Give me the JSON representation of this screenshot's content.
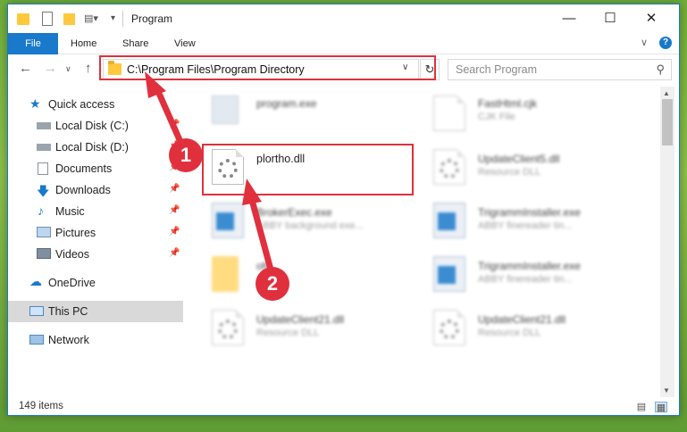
{
  "window": {
    "title": "Program"
  },
  "ribbon": {
    "file": "File",
    "home": "Home",
    "share": "Share",
    "view": "View"
  },
  "address_bar": {
    "path": "C:\\Program Files\\Program Directory"
  },
  "search": {
    "placeholder": "Search Program"
  },
  "sidebar": {
    "items": [
      {
        "label": "Quick access",
        "icon": "star-icon"
      },
      {
        "label": "Local Disk (C:)",
        "icon": "drive-icon"
      },
      {
        "label": "Local Disk (D:)",
        "icon": "drive-icon"
      },
      {
        "label": "Documents",
        "icon": "documents-icon"
      },
      {
        "label": "Downloads",
        "icon": "download-icon"
      },
      {
        "label": "Music",
        "icon": "music-icon"
      },
      {
        "label": "Pictures",
        "icon": "pictures-icon"
      },
      {
        "label": "Videos",
        "icon": "videos-icon"
      },
      {
        "label": "OneDrive",
        "icon": "cloud-icon"
      },
      {
        "label": "This PC",
        "icon": "computer-icon"
      },
      {
        "label": "Network",
        "icon": "network-icon"
      }
    ]
  },
  "files": [
    {
      "name": "program.exe",
      "type": ""
    },
    {
      "name": "FastHtml.cjk",
      "type": "CJK File"
    },
    {
      "name": "plortho.dll",
      "type": ""
    },
    {
      "name": "UpdateClient5.dll",
      "type": "Resource DLL"
    },
    {
      "name": "BrokerExec.exe",
      "type": "ABBY background exe..."
    },
    {
      "name": "TrigrammInstaller.exe",
      "type": "ABBY finereader tin..."
    },
    {
      "name": "ofc",
      "type": ""
    },
    {
      "name": "TrigrammInstaller.exe",
      "type": "ABBY finereader tin..."
    },
    {
      "name": "UpdateClient21.dll",
      "type": "Resource DLL"
    },
    {
      "name": "UpdateClient21.dll",
      "type": "Resource DLL"
    }
  ],
  "status": {
    "count": "149 items"
  },
  "annotations": {
    "step1": "1",
    "step2": "2"
  },
  "colors": {
    "accent": "#1979ca",
    "highlight": "#e1303d"
  }
}
